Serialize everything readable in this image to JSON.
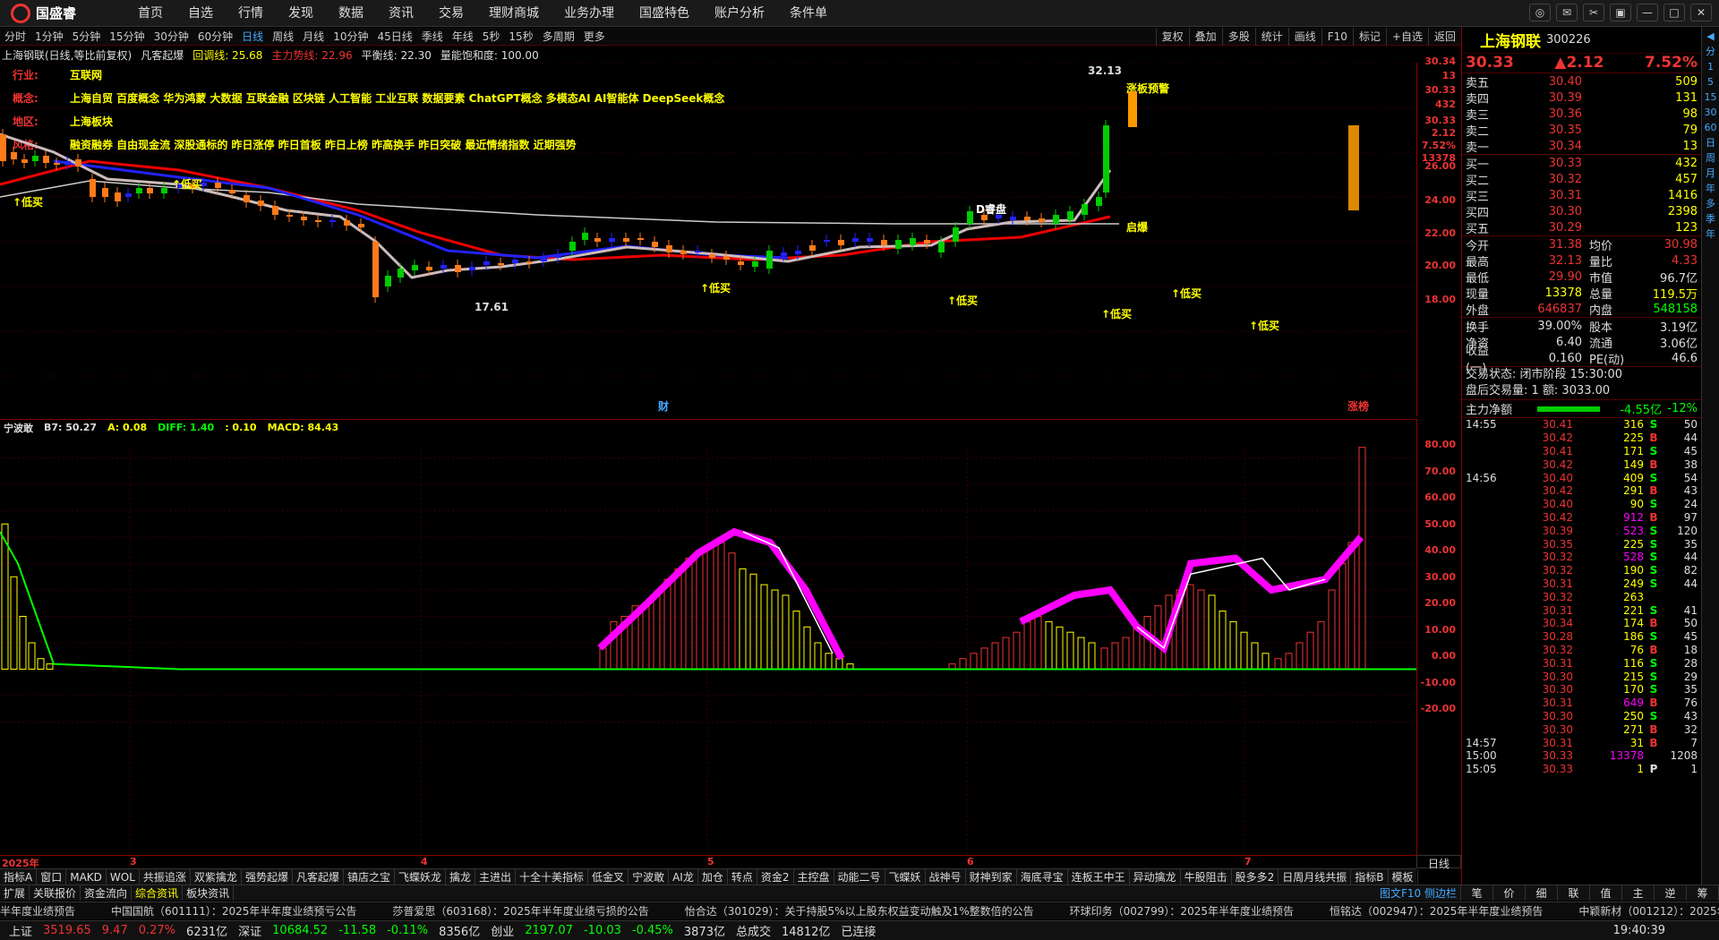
{
  "app": {
    "name": "国盛睿"
  },
  "nav": [
    "首页",
    "自选",
    "行情",
    "发现",
    "数据",
    "资讯",
    "交易",
    "理财商城",
    "业务办理",
    "国盛特色",
    "账户分析",
    "条件单"
  ],
  "periods": [
    "分时",
    "1分钟",
    "5分钟",
    "15分钟",
    "30分钟",
    "60分钟",
    "日线",
    "周线",
    "月线",
    "10分钟",
    "45日线",
    "季线",
    "年线",
    "5秒",
    "15秒",
    "多周期",
    "更多"
  ],
  "period_active": "日线",
  "period_tools": [
    "复权",
    "叠加",
    "多股",
    "统计",
    "画线",
    "F10",
    "标记",
    "+自选",
    "返回"
  ],
  "info": {
    "stock": "上海钢联(日线,等比前复权)",
    "indicator": "凡客起爆",
    "a": "回调线: 25.68",
    "b": "主力势线: 22.96",
    "c": "平衡线: 22.30",
    "d": "量能饱和度: 100.00"
  },
  "info_rows": [
    {
      "k": "行业:",
      "v": "互联网"
    },
    {
      "k": "概念:",
      "v": "上海自贸 百度概念 华为鸿蒙 大数据 互联金融 区块链 人工智能 工业互联 数据要素 ChatGPT概念 多模态AI AI智能体 DeepSeek概念"
    },
    {
      "k": "地区:",
      "v": "上海板块"
    },
    {
      "k": "风格:",
      "v": "融资融券 自由现金流 深股通标的 昨日涨停 昨日首板 昨日上榜 昨高换手 昨日突破 最近情绪指数 近期强势"
    }
  ],
  "chart1_ylabels": [
    "26.00",
    "24.00",
    "22.00",
    "20.00",
    "18.00"
  ],
  "chart1_labels": {
    "high": "32.13",
    "low": "17.61",
    "zt": "涨板预警",
    "dm": "D睿盘",
    "qb": "启爆",
    "cai": "财",
    "zb": "涨榜",
    "dm_buy": "低买",
    "top_right": [
      "30.34",
      "13",
      "30.33",
      "432",
      "30.33",
      "2.12",
      "7.52%",
      "13378"
    ]
  },
  "chart2_header": {
    "name": "宁波敢",
    "b7": "B7: 50.27",
    "a": "A: 0.08",
    "diff": "DIFF: 1.40",
    "c": ": 0.10",
    "macd": "MACD: 84.43"
  },
  "chart2_ylabels": [
    "80.00",
    "70.00",
    "60.00",
    "50.00",
    "40.00",
    "30.00",
    "20.00",
    "10.00",
    "0.00",
    "-10.00",
    "-20.00"
  ],
  "xlabels": [
    "2025年",
    "3",
    "4",
    "5",
    "6",
    "7"
  ],
  "xlabel_right": "日线",
  "tabs1": [
    "指标A",
    "窗口",
    "MAKD",
    "WOL",
    "共振追涨",
    "双紫擒龙",
    "强势起爆",
    "凡客起爆",
    "镇店之宝",
    "飞蝶妖龙",
    "擒龙",
    "主进出",
    "十全十美指标",
    "低金叉",
    "宁波敢",
    "AI龙",
    "加仓",
    "转点",
    "资金2",
    "主控盘",
    "动能二号",
    "飞蝶妖",
    "战神号",
    "财神到家",
    "海底寻宝",
    "连板王中王",
    "异动擒龙",
    "牛股阻击",
    "股多多2",
    "日周月线共振",
    "指标B",
    "模板"
  ],
  "tabs2": [
    "扩展",
    "关联报价",
    "资金流向",
    "综合资讯",
    "板块资讯"
  ],
  "tabs2_right": "图文F10 侧边栏",
  "ticker": [
    "半年度业绩预告",
    "中国国航（601111）：2025年半年度业绩预亏公告",
    "莎普爱思（603168）：2025年半年度业绩亏损的公告",
    "怡合达（301029）：关于持股5%以上股东权益变动触及1%整数倍的公告",
    "环球印务（002799）：2025年半年度业绩预告",
    "恒铭达（002947）：2025年半年度业绩预告",
    "中颖新材（001212）：2025年半"
  ],
  "status": {
    "sh_name": "上证",
    "sh_val": "3519.65",
    "sh_chg": "9.47",
    "sh_pct": "0.27%",
    "sh_amt": "6231亿",
    "sz_name": "深证",
    "sz_val": "10684.52",
    "sz_chg": "-11.58",
    "sz_pct": "-0.11%",
    "sz_amt": "8356亿",
    "cy_name": "创业",
    "cy_val": "2197.07",
    "cy_chg": "-10.03",
    "cy_pct": "-0.45%",
    "cy_amt": "3873亿",
    "total_label": "总成交",
    "total": "14812亿",
    "conn": "已连接",
    "time": "19:40:39"
  },
  "quote": {
    "name": "上海钢联",
    "code": "300226",
    "last": "30.33",
    "chg": "▲2.12",
    "pct": "7.52%",
    "sell": [
      [
        "卖五",
        "30.40",
        "509"
      ],
      [
        "卖四",
        "30.39",
        "131"
      ],
      [
        "卖三",
        "30.36",
        "98"
      ],
      [
        "卖二",
        "30.35",
        "79"
      ],
      [
        "卖一",
        "30.34",
        "13"
      ]
    ],
    "buy": [
      [
        "买一",
        "30.33",
        "432"
      ],
      [
        "买二",
        "30.32",
        "457"
      ],
      [
        "买三",
        "30.31",
        "1416"
      ],
      [
        "买四",
        "30.30",
        "2398"
      ],
      [
        "买五",
        "30.29",
        "123"
      ]
    ],
    "stats": [
      [
        "今开",
        "31.38",
        "均价",
        "30.98"
      ],
      [
        "最高",
        "32.13",
        "量比",
        "4.33"
      ],
      [
        "最低",
        "29.90",
        "市值",
        "96.7亿"
      ],
      [
        "现量",
        "13378",
        "总量",
        "119.5万"
      ],
      [
        "外盘",
        "646837",
        "内盘",
        "548158"
      ]
    ],
    "stats2": [
      [
        "换手",
        "39.00%",
        "股本",
        "3.19亿"
      ],
      [
        "净资",
        "6.40",
        "流通",
        "3.06亿"
      ],
      [
        "收益(一)",
        "0.160",
        "PE(动)",
        "46.6"
      ]
    ],
    "trade_state": "交易状态: 闭市阶段 15:30:00",
    "after": "盘后交易量: 1  额: 3033.00",
    "main_flow_label": "主力净额",
    "main_flow": "-4.55亿",
    "main_flow_pct": "-12%"
  },
  "ticks": [
    [
      "14:55",
      "30.41",
      "316",
      "S",
      "50"
    ],
    [
      "",
      "30.42",
      "225",
      "B",
      "44"
    ],
    [
      "",
      "30.41",
      "171",
      "S",
      "45"
    ],
    [
      "",
      "30.42",
      "149",
      "B",
      "38"
    ],
    [
      "14:56",
      "30.40",
      "409",
      "S",
      "54"
    ],
    [
      "",
      "30.42",
      "291",
      "B",
      "43"
    ],
    [
      "",
      "30.40",
      "90",
      "S",
      "24"
    ],
    [
      "",
      "30.42",
      "912",
      "B",
      "97"
    ],
    [
      "",
      "30.39",
      "523",
      "S",
      "120"
    ],
    [
      "",
      "30.35",
      "225",
      "S",
      "35"
    ],
    [
      "",
      "30.32",
      "528",
      "S",
      "44"
    ],
    [
      "",
      "30.32",
      "190",
      "S",
      "82"
    ],
    [
      "",
      "30.31",
      "249",
      "S",
      "44"
    ],
    [
      "",
      "30.32",
      "263",
      "",
      ""
    ],
    [
      "",
      "30.31",
      "221",
      "S",
      "41"
    ],
    [
      "",
      "30.34",
      "174",
      "B",
      "50"
    ],
    [
      "",
      "30.28",
      "186",
      "S",
      "45"
    ],
    [
      "",
      "30.32",
      "76",
      "B",
      "18"
    ],
    [
      "",
      "30.31",
      "116",
      "S",
      "28"
    ],
    [
      "",
      "30.30",
      "215",
      "S",
      "29"
    ],
    [
      "",
      "30.30",
      "170",
      "S",
      "35"
    ],
    [
      "",
      "30.31",
      "649",
      "B",
      "76"
    ],
    [
      "",
      "30.30",
      "250",
      "S",
      "43"
    ],
    [
      "",
      "30.30",
      "271",
      "B",
      "32"
    ],
    [
      "14:57",
      "30.31",
      "31",
      "B",
      "7"
    ],
    [
      "15:00",
      "30.33",
      "13378",
      "",
      "1208"
    ],
    [
      "15:05",
      "30.33",
      "1",
      "P",
      "1"
    ]
  ],
  "rsidebar": [
    "◀",
    "分",
    "1",
    "5",
    "15",
    "30",
    "60",
    "日",
    "周",
    "月",
    "年",
    "多",
    "季",
    "年"
  ],
  "rbottom": [
    "笔",
    "价",
    "细",
    "联",
    "值",
    "主",
    "逆",
    "筹"
  ]
}
